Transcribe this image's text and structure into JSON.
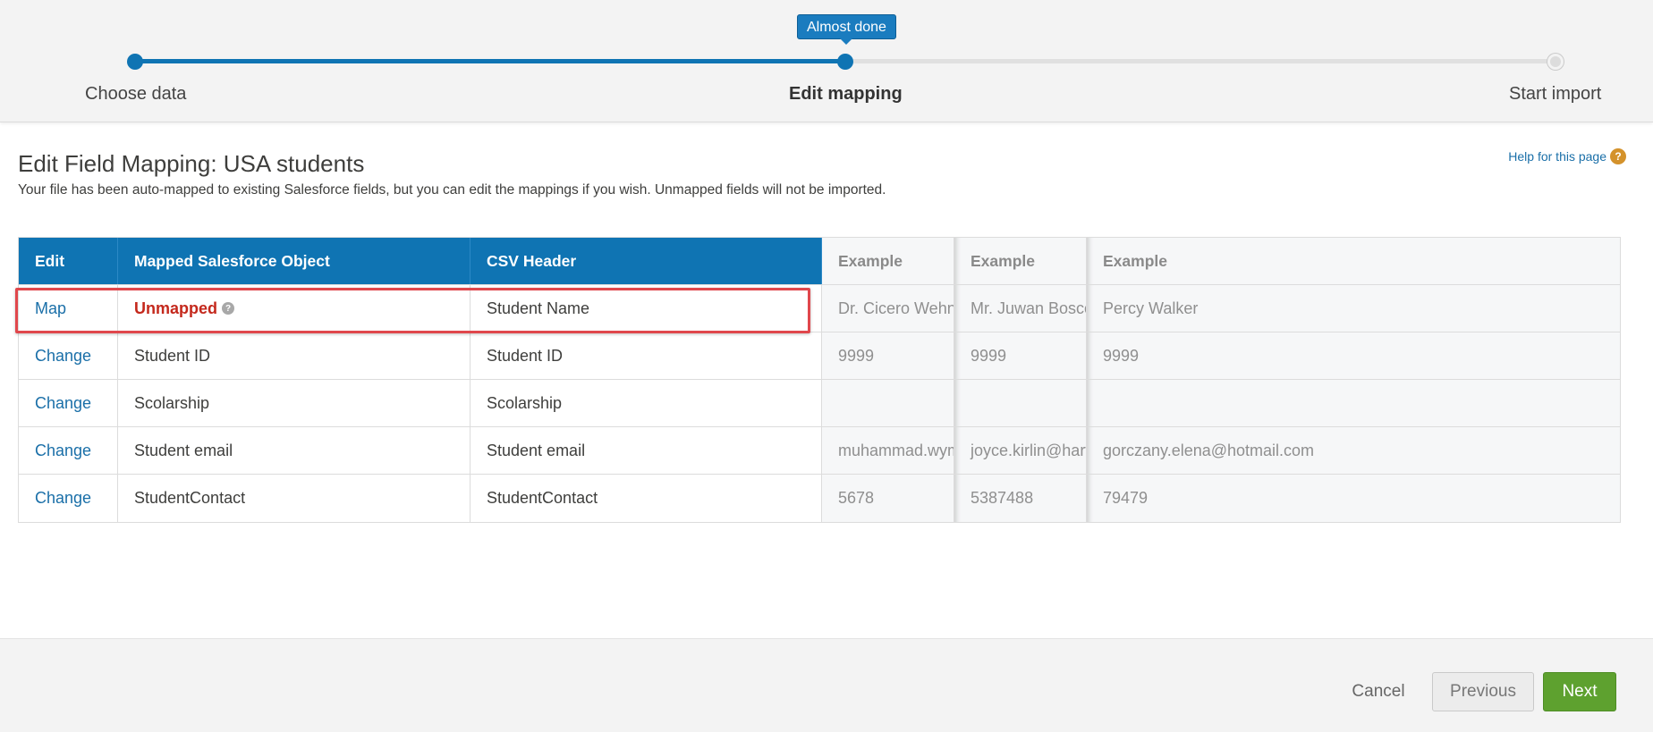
{
  "progress": {
    "tooltip": "Almost done",
    "steps": [
      {
        "label": "Choose data",
        "state": "done"
      },
      {
        "label": "Edit mapping",
        "state": "active"
      },
      {
        "label": "Start import",
        "state": "pending"
      }
    ],
    "accent_color": "#0f74b3"
  },
  "page": {
    "title": "Edit Field Mapping: USA students",
    "description": "Your file has been auto-mapped to existing Salesforce fields, but you can edit the mappings if you wish. Unmapped fields will not be imported.",
    "help_label": "Help for this page",
    "help_icon": "question-icon"
  },
  "table": {
    "headers": [
      "Edit",
      "Mapped Salesforce Object",
      "CSV Header",
      "Example",
      "Example",
      "Example"
    ],
    "rows": [
      {
        "edit": "Map",
        "object": "Unmapped",
        "csv": "Student Name",
        "ex1": "Dr. Cicero Wehner",
        "ex2": "Mr. Juwan Bosco",
        "ex3": "Percy Walker",
        "unmapped": true
      },
      {
        "edit": "Change",
        "object": "Student ID",
        "csv": "Student ID",
        "ex1": "9999",
        "ex2": "9999",
        "ex3": "9999"
      },
      {
        "edit": "Change",
        "object": "Scolarship",
        "csv": "Scolarship",
        "ex1": "",
        "ex2": "",
        "ex3": ""
      },
      {
        "edit": "Change",
        "object": "Student email",
        "csv": "Student email",
        "ex1": "muhammad.wym",
        "ex2": "joyce.kirlin@harv",
        "ex3": "gorczany.elena@hotmail.com"
      },
      {
        "edit": "Change",
        "object": "StudentContact",
        "csv": "StudentContact",
        "ex1": "5678",
        "ex2": "5387488",
        "ex3": "79479"
      }
    ]
  },
  "footer": {
    "cancel": "Cancel",
    "previous": "Previous",
    "next": "Next",
    "next_color": "#5ea12f"
  }
}
